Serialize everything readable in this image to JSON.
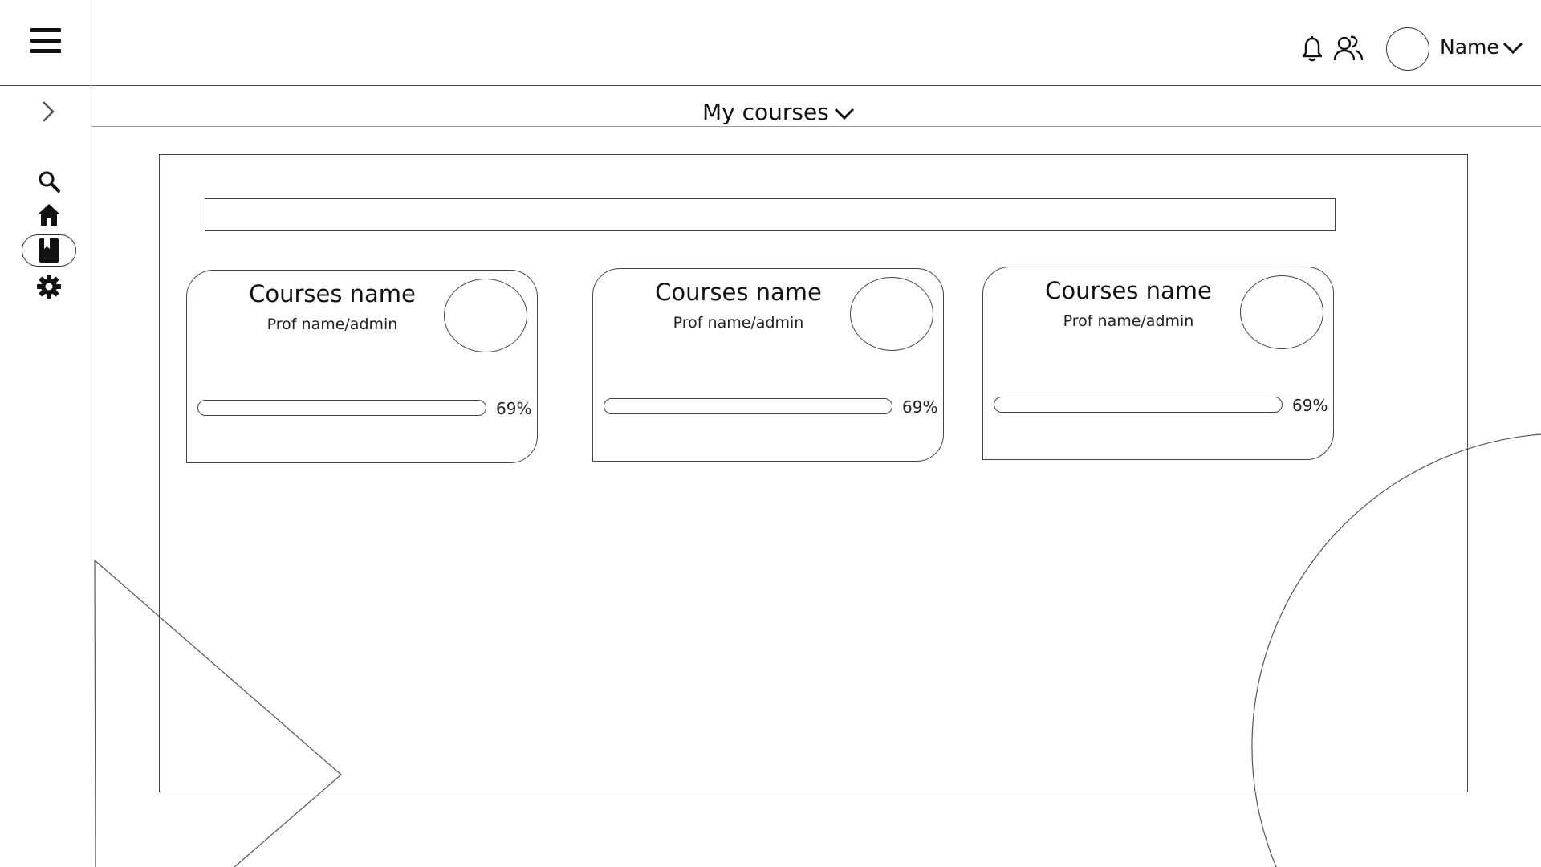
{
  "header": {
    "user_name": "Name",
    "icons": {
      "menu": "hamburger-menu-icon",
      "notifications": "bell-icon",
      "people": "users-icon",
      "dropdown": "chevron-down-icon"
    }
  },
  "sidebar": {
    "items": [
      {
        "icon": "search-icon",
        "active": false
      },
      {
        "icon": "home-icon",
        "active": false
      },
      {
        "icon": "book-icon",
        "active": true
      },
      {
        "icon": "gear-icon",
        "active": false
      }
    ]
  },
  "page": {
    "title": "My courses"
  },
  "search": {
    "value": "",
    "placeholder": ""
  },
  "courses": [
    {
      "name": "Courses name",
      "prof": "Prof name/admin",
      "progress_percent": 69,
      "progress_label": "69%"
    },
    {
      "name": "Courses name",
      "prof": "Prof name/admin",
      "progress_percent": 69,
      "progress_label": "69%"
    },
    {
      "name": "Courses name",
      "prof": "Prof name/admin",
      "progress_percent": 69,
      "progress_label": "69%"
    }
  ],
  "colors": {
    "line": "#4a4a4a",
    "background": "#ffffff",
    "text": "#111111"
  }
}
